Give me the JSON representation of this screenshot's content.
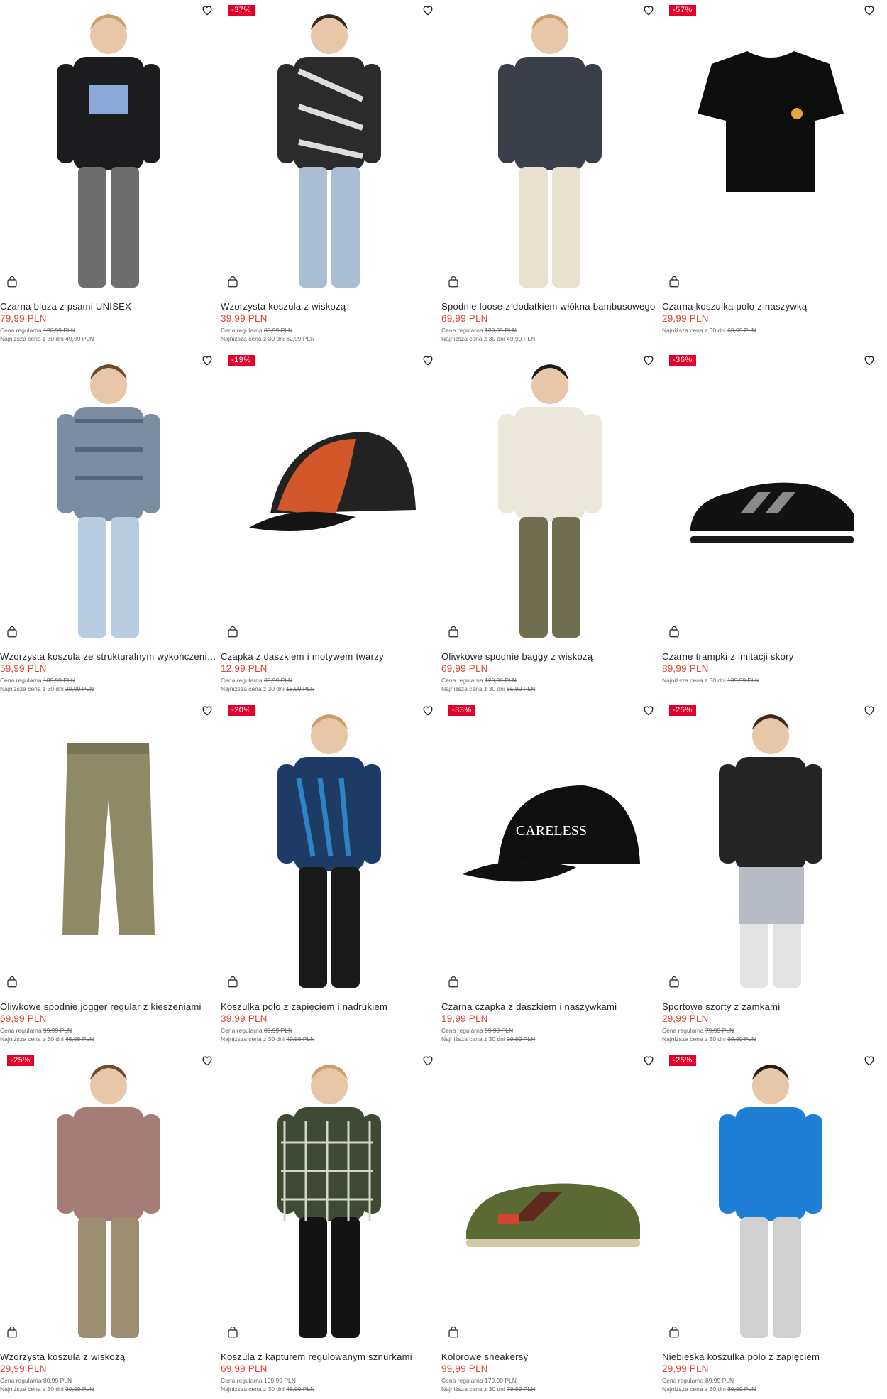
{
  "labels": {
    "regular_prefix": "Cena regularna",
    "lowest_prefix": "Najniższa cena z 30 dni"
  },
  "colors": {
    "price": "#e0452f",
    "badge": "#e4002b"
  },
  "products": [
    {
      "name": "Czarna bluza z psami UNISEX",
      "price": "79,99 PLN",
      "regular": "120,99 PLN",
      "lowest": "49,99 PLN",
      "badge": "",
      "image": "black-hoodie"
    },
    {
      "name": "Wzorzysta koszula z wiskozą",
      "price": "39,99 PLN",
      "regular": "80,99 PLN",
      "lowest": "62,99 PLN",
      "badge": "-37%",
      "image": "patterned-shirt"
    },
    {
      "name": "Spodnie loose z dodatkiem włókna bambusowego",
      "price": "69,99 PLN",
      "regular": "120,99 PLN",
      "lowest": "49,99 PLN",
      "badge": "",
      "image": "loose-trousers"
    },
    {
      "name": "Czarna koszulka polo z naszywką",
      "price": "29,99 PLN",
      "regular": "",
      "lowest": "69,99 PLN",
      "badge": "-57%",
      "image": "black-polo"
    },
    {
      "name": "Wzorzysta koszula ze strukturalnym wykończeniem",
      "price": "59,99 PLN",
      "regular": "109,99 PLN",
      "lowest": "39,99 PLN",
      "badge": "",
      "image": "structured-shirt"
    },
    {
      "name": "Czapka z daszkiem i motywem twarzy",
      "price": "12,99 PLN",
      "regular": "39,99 PLN",
      "lowest": "15,99 PLN",
      "badge": "-19%",
      "image": "face-cap"
    },
    {
      "name": "Oliwkowe spodnie baggy z wiskozą",
      "price": "69,99 PLN",
      "regular": "120,99 PLN",
      "lowest": "55,99 PLN",
      "badge": "",
      "image": "olive-baggy"
    },
    {
      "name": "Czarne trampki z imitacji skóry",
      "price": "89,99 PLN",
      "regular": "",
      "lowest": "139,99 PLN",
      "badge": "-36%",
      "image": "black-sneakers"
    },
    {
      "name": "Oliwkowe spodnie jogger regular z kieszeniami",
      "price": "69,99 PLN",
      "regular": "99,99 PLN",
      "lowest": "45,99 PLN",
      "badge": "",
      "image": "olive-joggers"
    },
    {
      "name": "Koszulka polo z zapięciem i nadrukiem",
      "price": "39,99 PLN",
      "regular": "89,99 PLN",
      "lowest": "49,99 PLN",
      "badge": "-20%",
      "image": "print-polo"
    },
    {
      "name": "Czarna czapka z daszkiem i naszywkami",
      "price": "19,99 PLN",
      "regular": "59,99 PLN",
      "lowest": "29,99 PLN",
      "badge": "-33%",
      "image": "black-cap"
    },
    {
      "name": "Sportowe szorty z zamkami",
      "price": "29,99 PLN",
      "regular": "79,99 PLN",
      "lowest": "39,99 PLN",
      "badge": "-25%",
      "image": "sport-shorts"
    },
    {
      "name": "Wzorzysta koszula z wiskozą",
      "price": "29,99 PLN",
      "regular": "80,99 PLN",
      "lowest": "39,99 PLN",
      "badge": "-25%",
      "image": "tiedye-shirt"
    },
    {
      "name": "Koszula z kapturem regulowanym sznurkami",
      "price": "69,99 PLN",
      "regular": "109,99 PLN",
      "lowest": "45,99 PLN",
      "badge": "",
      "image": "check-overshirt"
    },
    {
      "name": "Kolorowe sneakersy",
      "price": "99,99 PLN",
      "regular": "179,99 PLN",
      "lowest": "79,99 PLN",
      "badge": "",
      "image": "olive-sneakers"
    },
    {
      "name": "Niebieska koszulka polo z zapięciem",
      "price": "29,99 PLN",
      "regular": "89,99 PLN",
      "lowest": "39,99 PLN",
      "badge": "-25%",
      "image": "blue-polo"
    }
  ]
}
